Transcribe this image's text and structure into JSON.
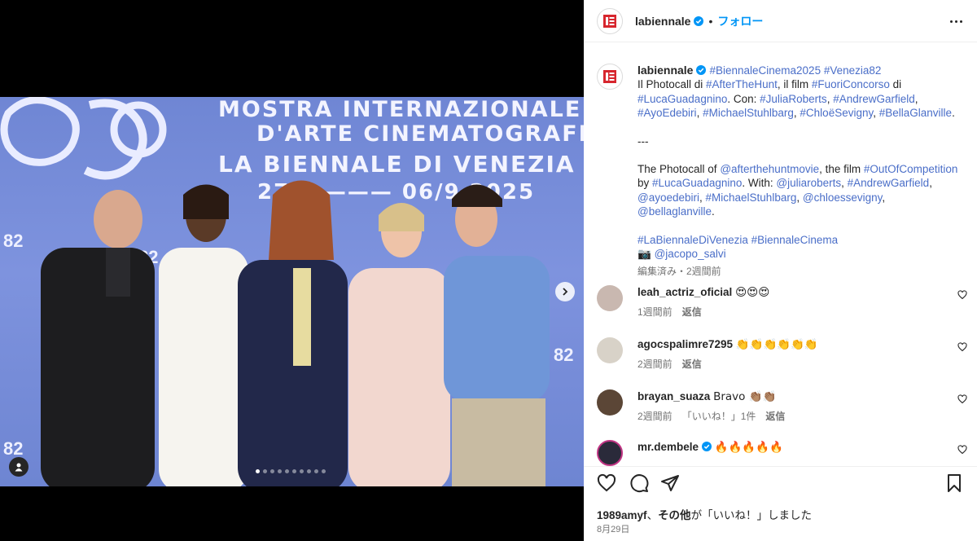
{
  "post": {
    "username": "labiennale",
    "follow_label": "フォロー",
    "separator": "•"
  },
  "backdrop": {
    "line1": "MOSTRA INTERNAZIONALE",
    "line2": "D'ARTE CINEMATOGRAFICA",
    "line3": "LA BIENNALE DI VENEZIA",
    "line4": "27/8 ——— 06/9 2025",
    "logo_number": "82"
  },
  "carousel": {
    "dot_count": 10,
    "active_index": 0
  },
  "caption": {
    "username": "labiennale",
    "hashtags_top": "#BiennaleCinema2025 #Venezia82",
    "it_p1": "Il Photocall di ",
    "it_link1": "#AfterTheHunt",
    "it_p2": ", il film ",
    "it_link2": "#FuoriConcorso",
    "it_p3": " di ",
    "it_link3": "#LucaGuadagnino",
    "it_p4": ". Con: ",
    "it_link4": "#JuliaRoberts",
    "it_p5": ", ",
    "it_link5": "#AndrewGarfield",
    "it_p6": ", ",
    "it_link6": "#AyoEdebiri",
    "it_p7": ", ",
    "it_link7": "#MichaelStuhlbarg",
    "it_p8": ", ",
    "it_link8": "#ChloëSevigny",
    "it_p9": ", ",
    "it_link9": "#BellaGlanville",
    "it_p10": ".",
    "divider": "---",
    "en_p1": "The Photocall of ",
    "en_link1": "@afterthehuntmovie",
    "en_p2": ", the film ",
    "en_link2": "#OutOfCompetition",
    "en_p3": " by ",
    "en_link3": "#LucaGuadagnino",
    "en_p4": ". With: ",
    "en_link4": "@juliaroberts",
    "en_p5": ", ",
    "en_link5": "#AndrewGarfield",
    "en_p6": ", ",
    "en_link6": "@ayoedebiri",
    "en_p7": ", ",
    "en_link7": "#MichaelStuhlbarg",
    "en_p8": ", ",
    "en_link8": "@chloessevigny",
    "en_p9": ", ",
    "en_link9": "@bellaglanville",
    "en_p10": ".",
    "tags_bottom": "#LaBiennaleDiVenezia #BiennaleCinema",
    "camera_emoji": "📷",
    "photographer": "@jacopo_salvi",
    "meta": "編集済み・2週間前"
  },
  "comments": [
    {
      "username": "leah_actriz_oficial",
      "text": "😍😍😍",
      "time": "1週間前",
      "reply": "返信",
      "likes": "",
      "avatar_color": "#c9b8b0"
    },
    {
      "username": "agocspalimre7295",
      "text": "👏👏👏👏👏👏",
      "time": "2週間前",
      "reply": "返信",
      "likes": "",
      "avatar_color": "#d8d2c8"
    },
    {
      "username": "brayan_suaza",
      "text": "Bravo 👏🏽👏🏽",
      "time": "2週間前",
      "reply": "返信",
      "likes": "「いいね！」1件",
      "avatar_color": "#5b4636"
    },
    {
      "username": "mr.dembele",
      "text": "🔥🔥🔥🔥🔥",
      "time": "",
      "reply": "",
      "likes": "",
      "avatar_color": "#2a2a3a"
    }
  ],
  "footer": {
    "likes_user": "1989amyf",
    "likes_mid": "、",
    "likes_others": "その他",
    "likes_rest": "が「いいね！」しました",
    "date": "8月29日"
  },
  "colors": {
    "accent": "#0095f6",
    "link": "#4a6ec8",
    "biennale_red": "#d7262e",
    "backdrop_blue": "#7a90da"
  }
}
